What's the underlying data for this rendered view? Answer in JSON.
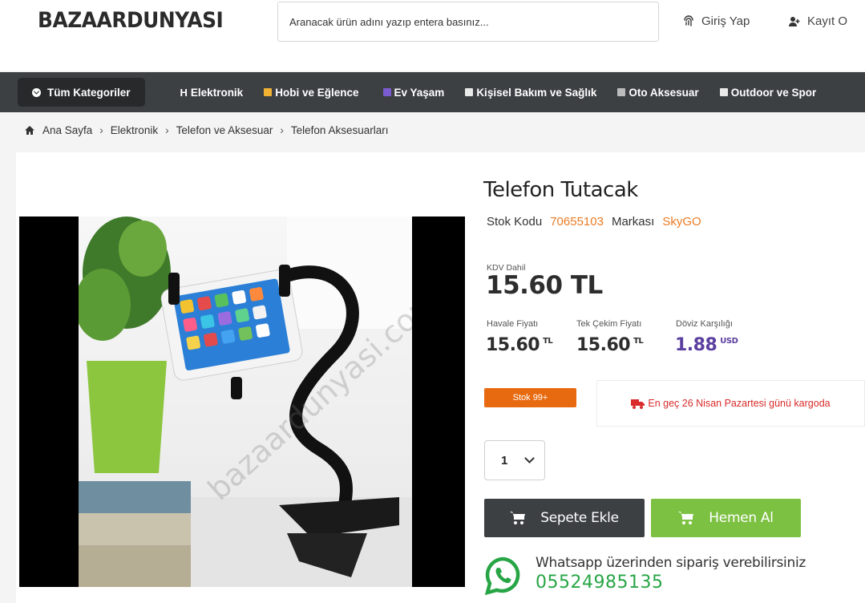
{
  "header": {
    "logo": "BAZAARDUNYASI",
    "search_placeholder": "Aranacak ürün adını yazıp entera basınız...",
    "login_label": "Giriş Yap",
    "register_label": "Kayıt O"
  },
  "nav": {
    "all_categories": "Tüm Kategoriler",
    "items": [
      {
        "label": "Elektronik"
      },
      {
        "label": "Hobi ve Eğlence"
      },
      {
        "label": "Ev Yaşam"
      },
      {
        "label": "Kişisel Bakım ve Sağlık"
      },
      {
        "label": "Oto Aksesuar"
      },
      {
        "label": "Outdoor ve Spor"
      }
    ]
  },
  "breadcrumb": [
    "Ana Sayfa",
    "Elektronik",
    "Telefon ve Aksesuar",
    "Telefon Aksesuarları"
  ],
  "product": {
    "title": "Telefon Tutacak",
    "stock_code_label": "Stok Kodu",
    "stock_code": "70655103",
    "brand_label": "Markası",
    "brand": "SkyGO",
    "kdv_label": "KDV Dahil",
    "price": "15.60 TL",
    "havale_label": "Havale Fiyatı",
    "havale_value": "15.60",
    "havale_unit": "TL",
    "tek_cekim_label": "Tek Çekim Fiyatı",
    "tek_cekim_value": "15.60",
    "tek_cekim_unit": "TL",
    "doviz_label": "Döviz Karşılığı",
    "doviz_value": "1.88",
    "doviz_unit": "USD",
    "stock_badge": "Stok 99+",
    "cargo_text": "En geç 26 Nisan Pazartesi günü kargoda",
    "quantity": "1",
    "add_to_cart": "Sepete Ekle",
    "buy_now": "Hemen Al",
    "whatsapp_text": "Whatsapp üzerinden sipariş verebilirsiniz",
    "whatsapp_phone": "05524985135",
    "watermark": "bazaardunyasi.com"
  },
  "colors": {
    "nav_bg": "#3c4043",
    "accent_orange": "#ea7b24",
    "buy_green": "#7cc142",
    "whatsapp_green": "#27a545",
    "cargo_red": "#d92b2b",
    "usd_purple": "#5b3fa0"
  }
}
